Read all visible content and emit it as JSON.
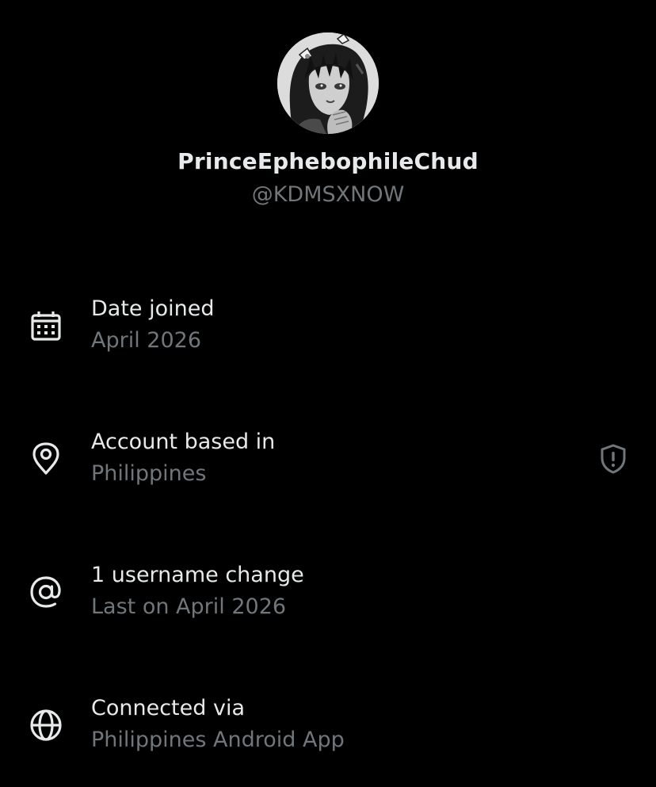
{
  "profile": {
    "display_name": "PrinceEphebophileChud",
    "handle": "@KDMSXNOW"
  },
  "details": {
    "date_joined": {
      "icon": "calendar-icon",
      "title": "Date joined",
      "value": "April 2026"
    },
    "account_based": {
      "icon": "location-pin-icon",
      "title": "Account based in",
      "value": "Philippines",
      "trailing_icon": "shield-alert-icon"
    },
    "username_changes": {
      "icon": "at-sign-icon",
      "title": "1 username change",
      "value": "Last on April 2026"
    },
    "connected_via": {
      "icon": "globe-icon",
      "title": "Connected via",
      "value": "Philippines Android App"
    }
  },
  "colors": {
    "background": "#000000",
    "primary_text": "#e7e9ea",
    "secondary_text": "#71767b",
    "icon": "#e7e9ea"
  }
}
